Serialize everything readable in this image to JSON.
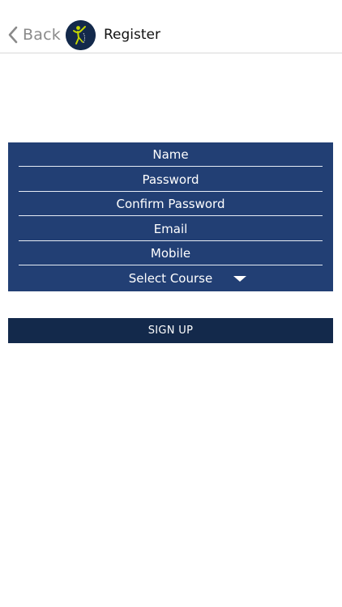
{
  "nav": {
    "back_label": "Back",
    "title": "Register"
  },
  "form": {
    "fields": [
      {
        "label": "Name"
      },
      {
        "label": "Password"
      },
      {
        "label": "Confirm Password"
      },
      {
        "label": "Email"
      },
      {
        "label": "Mobile"
      }
    ],
    "course_select": {
      "label": "Select Course"
    }
  },
  "signup": {
    "label": "SIGN UP"
  },
  "colors": {
    "panel": "#223f74",
    "button": "#13294b",
    "logo_bg": "#13294b",
    "logo_figure": "#c4d600"
  },
  "icons": {
    "back": "chevron-left-icon",
    "logo": "app-logo",
    "dropdown": "caret-down-icon"
  }
}
